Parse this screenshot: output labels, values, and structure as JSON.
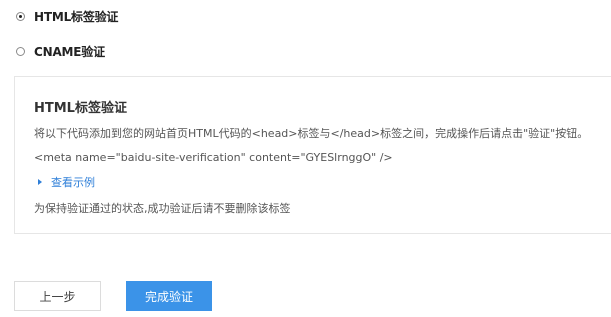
{
  "verification_options": [
    {
      "label": "HTML标签验证",
      "selected": true
    },
    {
      "label": "CNAME验证",
      "selected": false
    }
  ],
  "panel": {
    "title": "HTML标签验证",
    "instruction": "将以下代码添加到您的网站首页HTML代码的<head>标签与</head>标签之间，完成操作后请点击\"验证\"按钮。",
    "meta_code": "<meta name=\"baidu-site-verification\" content=\"GYESlrnggO\" />",
    "example_toggle": "查看示例",
    "note": "为保持验证通过的状态,成功验证后请不要删除该标签"
  },
  "buttons": {
    "back": "上一步",
    "done": "完成验证"
  },
  "colors": {
    "link": "#2f7fd8",
    "primary_button": "#3b93e8"
  }
}
